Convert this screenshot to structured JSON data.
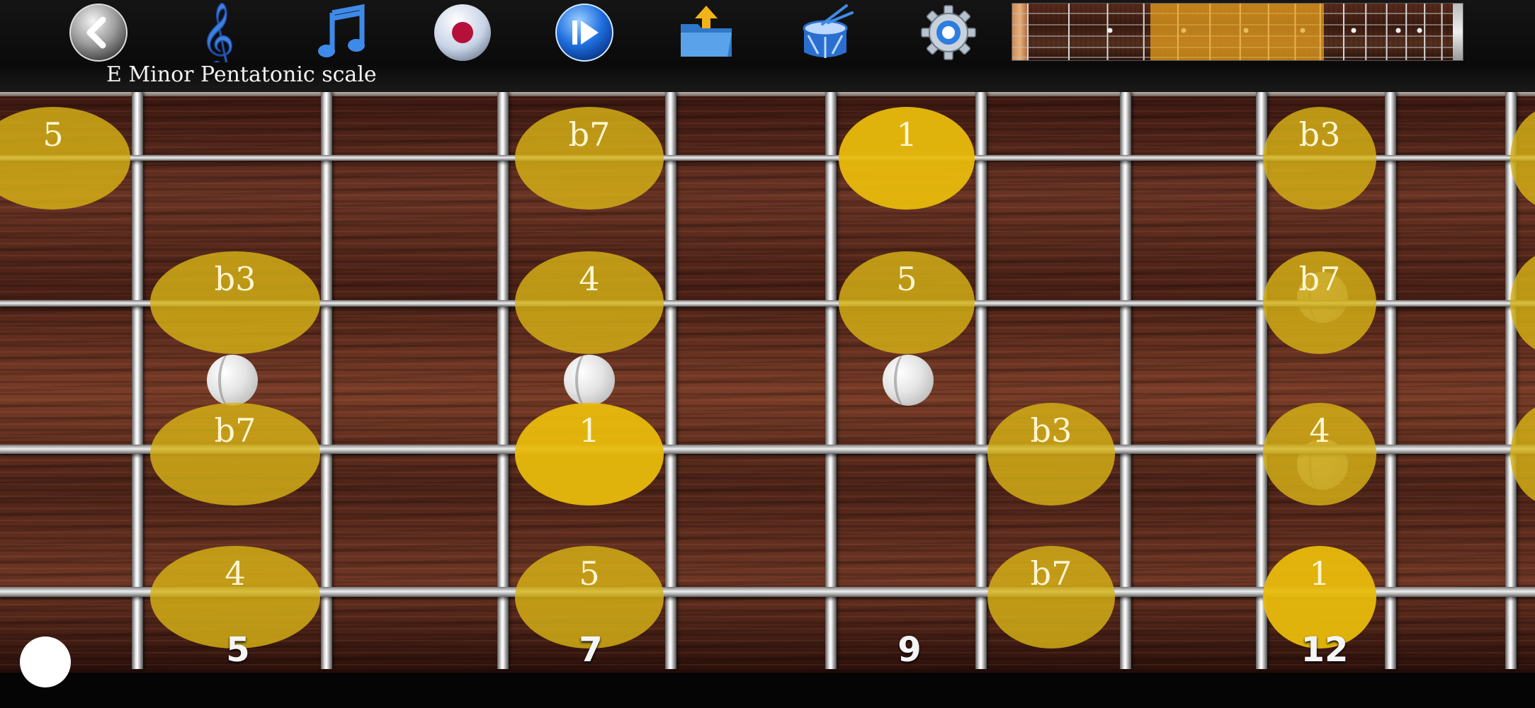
{
  "toolbar": {
    "scale_title": "E Minor Pentatonic scale",
    "items": [
      {
        "name": "back-button",
        "icon": "chevron-left-icon"
      },
      {
        "name": "scale-select-button",
        "icon": "treble-clef-icon"
      },
      {
        "name": "notes-button",
        "icon": "music-note-icon"
      },
      {
        "name": "record-button",
        "icon": "record-icon"
      },
      {
        "name": "play-button",
        "icon": "play-icon"
      },
      {
        "name": "open-folder-button",
        "icon": "folder-upload-icon"
      },
      {
        "name": "drum-button",
        "icon": "drum-icon"
      },
      {
        "name": "settings-button",
        "icon": "gear-icon"
      }
    ]
  },
  "fret_numbers": [
    "5",
    "7",
    "9",
    "12"
  ],
  "notes": {
    "string1": [
      "5",
      "b7",
      "1",
      "b3"
    ],
    "string2": [
      "b3",
      "4",
      "5",
      "b7"
    ],
    "string3": [
      "b7",
      "1",
      "b3",
      "4"
    ],
    "string4": [
      "4",
      "5",
      "b7",
      "1"
    ]
  },
  "colors": {
    "note_fill": "#d7b216",
    "highlight_window": "#eca41e"
  }
}
